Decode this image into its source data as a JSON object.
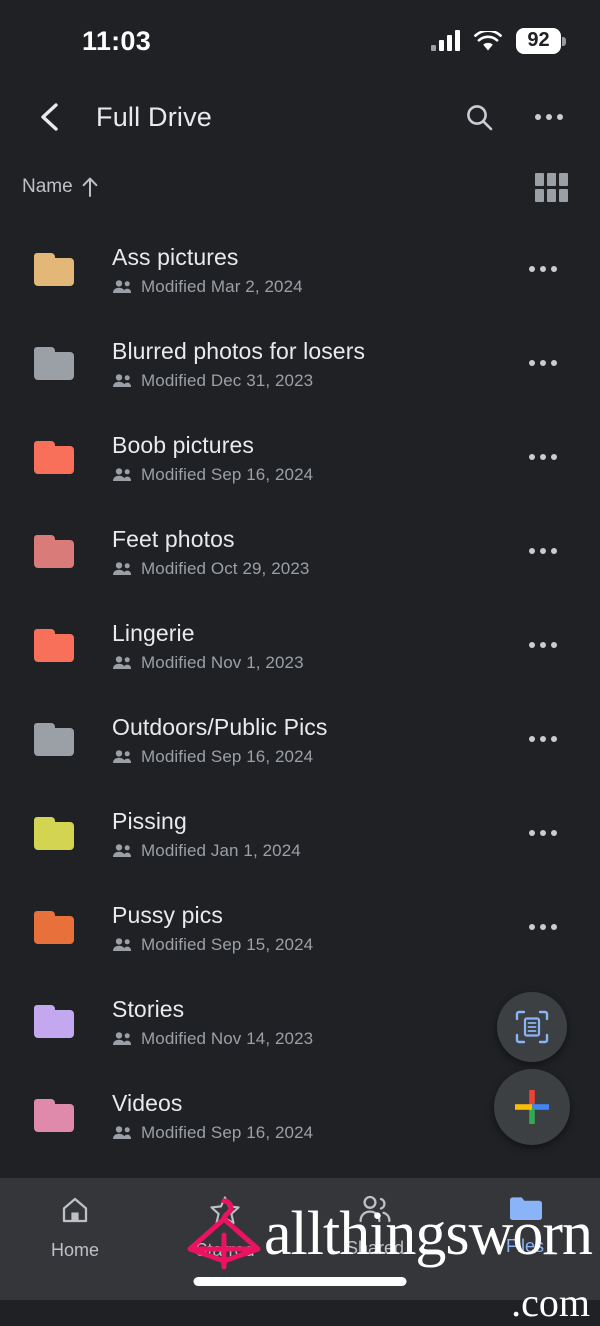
{
  "status_bar": {
    "time": "11:03",
    "battery_level": "92",
    "cellular_icon": "signal-bars-icon",
    "wifi_icon": "wifi-icon",
    "battery_icon": "battery-icon"
  },
  "app_bar": {
    "back_icon": "back-chevron-icon",
    "title": "Full Drive",
    "search_icon": "search-icon",
    "overflow_icon": "more-options-icon"
  },
  "sort_bar": {
    "sort_label": "Name",
    "sort_direction_icon": "arrow-up-icon",
    "view_toggle_icon": "grid-view-icon"
  },
  "colors": {
    "background": "#202124",
    "bottom_nav_background": "#35363a",
    "accent": "#8ab4f8",
    "primary_text": "#e8eaed",
    "secondary_text": "#9aa0a6",
    "watermark_pink": "#eb1361"
  },
  "files": {
    "modified_prefix": "Modified",
    "shared_icon": "shared-people-icon",
    "row_overflow_icon": "more-options-icon",
    "items": [
      {
        "name": "Ass pictures",
        "modified": "Modified Mar 2, 2024",
        "color": "#e2b778",
        "shared": true
      },
      {
        "name": "Blurred photos for losers",
        "modified": "Modified Dec 31, 2023",
        "color": "#9aa0a6",
        "shared": true
      },
      {
        "name": "Boob pictures",
        "modified": "Modified Sep 16, 2024",
        "color": "#f9705a",
        "shared": true
      },
      {
        "name": "Feet photos",
        "modified": "Modified Oct 29, 2023",
        "color": "#d97b79",
        "shared": true
      },
      {
        "name": "Lingerie",
        "modified": "Modified Nov 1, 2023",
        "color": "#f9705a",
        "shared": true
      },
      {
        "name": "Outdoors/Public Pics",
        "modified": "Modified Sep 16, 2024",
        "color": "#9aa0a6",
        "shared": true
      },
      {
        "name": "Pissing",
        "modified": "Modified Jan 1, 2024",
        "color": "#d4d453",
        "shared": true
      },
      {
        "name": "Pussy pics",
        "modified": "Modified Sep 15, 2024",
        "color": "#e8703a",
        "shared": true
      },
      {
        "name": "Stories",
        "modified": "Modified Nov 14, 2023",
        "color": "#c3a8f0",
        "shared": true
      },
      {
        "name": "Videos",
        "modified": "Modified Sep 16, 2024",
        "color": "#e08aab",
        "shared": true
      }
    ]
  },
  "fabs": {
    "scan_icon": "document-scan-icon",
    "new_icon": "plus-icon"
  },
  "bottom_nav": {
    "items": [
      {
        "label": "Home",
        "icon": "home-icon",
        "active": false
      },
      {
        "label": "Starred",
        "icon": "star-icon",
        "active": false
      },
      {
        "label": "Shared",
        "icon": "people-icon",
        "active": false
      },
      {
        "label": "Files",
        "icon": "folder-icon",
        "active": true
      }
    ]
  },
  "watermark": {
    "text": "allthingsworn",
    "suffix": ".com",
    "logo_icon": "hanger-logo-icon"
  }
}
